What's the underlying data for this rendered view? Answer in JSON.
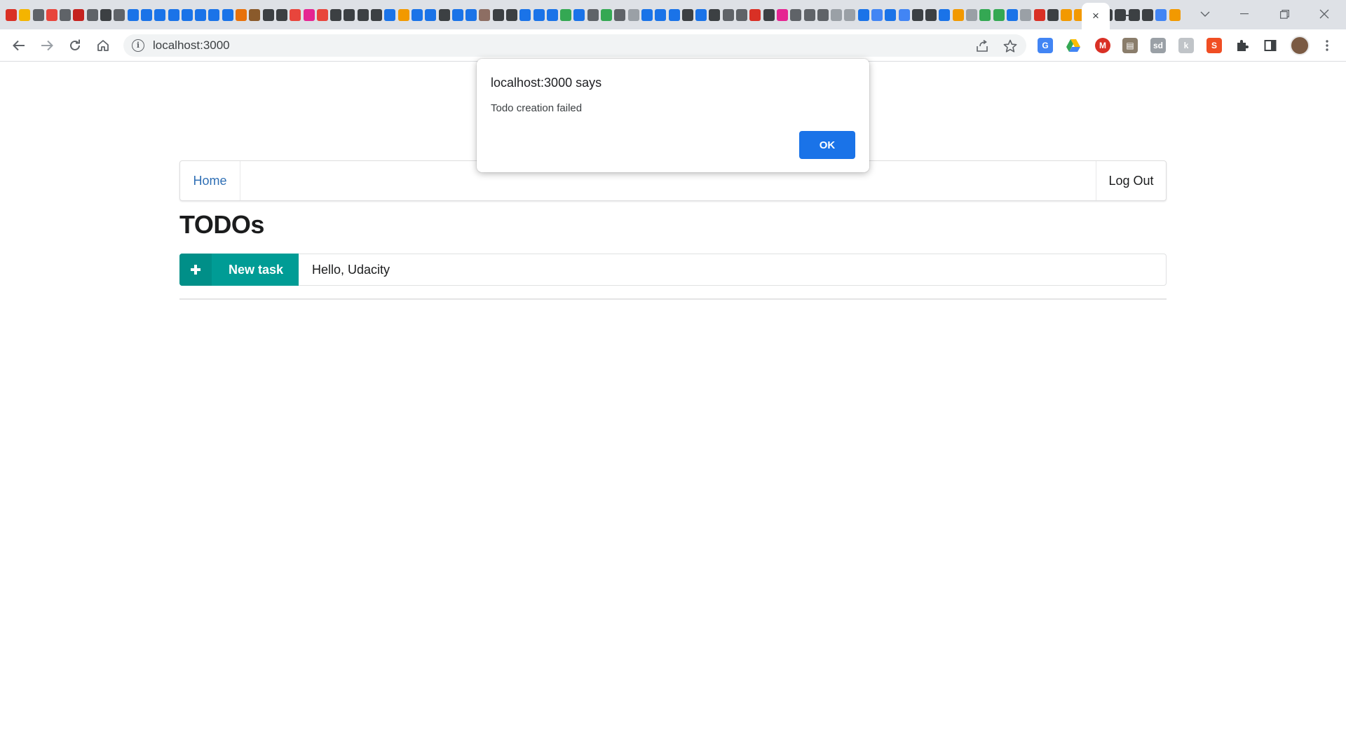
{
  "browser": {
    "active_tab_close_glyph": "×",
    "new_tab_glyph": "+",
    "address": "localhost:3000",
    "favicon_colors": [
      "#d93025",
      "#f4b400",
      "#5f6368",
      "#e8453c",
      "#5f6368",
      "#c5221f",
      "#5f6368",
      "#3c4043",
      "#5f6368",
      "#1a73e8",
      "#1a73e8",
      "#1a73e8",
      "#1a73e8",
      "#1a73e8",
      "#1a73e8",
      "#1a73e8",
      "#1a73e8",
      "#e8710a",
      "#8a5a2b",
      "#3c4043",
      "#3c4043",
      "#e8453c",
      "#e52592",
      "#e8453c",
      "#3c4043",
      "#3c4043",
      "#3c4043",
      "#3c4043",
      "#1a73e8",
      "#f29900",
      "#1a73e8",
      "#1a73e8",
      "#3c4043",
      "#1a73e8",
      "#1a73e8",
      "#8d6e63",
      "#3c4043",
      "#3c4043",
      "#1a73e8",
      "#1a73e8",
      "#1a73e8",
      "#34a853",
      "#1a73e8",
      "#5f6368",
      "#34a853",
      "#5f6368",
      "#9aa0a6",
      "#1a73e8",
      "#1a73e8",
      "#1a73e8",
      "#3c4043",
      "#1a73e8",
      "#3c4043",
      "#5f6368",
      "#5f6368",
      "#d93025",
      "#3c4043",
      "#e52592",
      "#5f6368",
      "#5f6368",
      "#5f6368",
      "#9aa0a6",
      "#9aa0a6",
      "#1a73e8",
      "#4285f4",
      "#1a73e8",
      "#4285f4",
      "#3c4043",
      "#3c4043",
      "#1a73e8",
      "#f29900",
      "#9aa0a6",
      "#34a853",
      "#34a853",
      "#1a73e8",
      "#9aa0a6",
      "#d93025",
      "#3c4043",
      "#f29900",
      "#f29900",
      "#34a853",
      "#3c4043",
      "#3c4043",
      "#3c4043",
      "#3c4043",
      "#4285f4",
      "#f29900"
    ]
  },
  "navbar": {
    "home_label": "Home",
    "logout_label": "Log Out"
  },
  "page": {
    "title": "TODOs",
    "new_task_label": "New task",
    "task_input_value": "Hello, Udacity"
  },
  "dialog": {
    "title": "localhost:3000 says",
    "message": "Todo creation failed",
    "ok_label": "OK"
  },
  "colors": {
    "accent_teal": "#009c95",
    "dialog_button": "#1a73e8",
    "link_blue": "#2f6fb5"
  }
}
